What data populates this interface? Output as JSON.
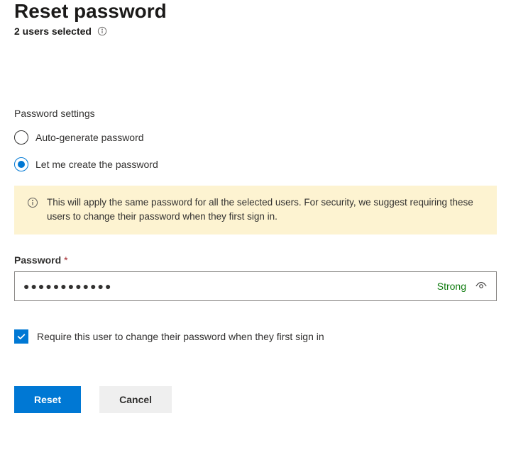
{
  "header": {
    "title": "Reset password",
    "subtitle": "2 users selected"
  },
  "section_label": "Password settings",
  "radio_options": {
    "auto": "Auto-generate password",
    "manual": "Let me create the password"
  },
  "notice": "This will apply the same password for all the selected users. For security, we suggest requiring these users to change their password when they first sign in.",
  "password_field": {
    "label": "Password",
    "required_mark": "*",
    "value": "●●●●●●●●●●●●",
    "strength": "Strong"
  },
  "require_change_label": "Require this user to change their password when they first sign in",
  "buttons": {
    "reset": "Reset",
    "cancel": "Cancel"
  }
}
